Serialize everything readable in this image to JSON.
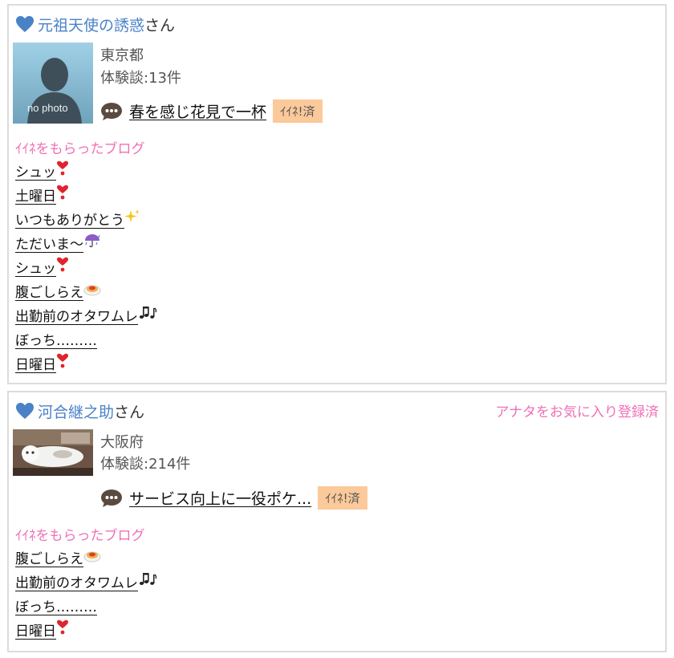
{
  "cards": [
    {
      "user_name": "元祖天使の誘惑",
      "honorific": "さん",
      "avatar_caption": "no photo",
      "prefecture": "東京都",
      "reviews": "体験談:13件",
      "latest_blog": "春を感じ花見で一杯",
      "iine_badge": "ｲｲﾈ!済",
      "liked_heading": "ｲｲﾈをもらったブログ",
      "liked_blogs": [
        {
          "title": "シュッ",
          "emoji": "heart-exclamation"
        },
        {
          "title": "土曜日",
          "emoji": "heart-exclamation"
        },
        {
          "title": "いつもありがとう",
          "emoji": "sparkles"
        },
        {
          "title": "ただいま〜",
          "emoji": "umbrella-rain"
        },
        {
          "title": "シュッ",
          "emoji": "heart-exclamation"
        },
        {
          "title": "腹ごしらえ",
          "emoji": "spaghetti"
        },
        {
          "title": "出勤前のオタワムレ",
          "emoji": "musical-notes"
        },
        {
          "title": "ぼっち………",
          "emoji": ""
        },
        {
          "title": "日曜日",
          "emoji": "heart-exclamation"
        }
      ]
    },
    {
      "user_name": "河合継之助",
      "honorific": "さん",
      "favorite_note": "アナタをお気に入り登録済",
      "prefecture": "大阪府",
      "reviews": "体験談:214件",
      "latest_blog": "サービス向上に一役ポケ...",
      "iine_badge": "ｲｲﾈ!済",
      "liked_heading": "ｲｲﾈをもらったブログ",
      "liked_blogs": [
        {
          "title": "腹ごしらえ",
          "emoji": "spaghetti"
        },
        {
          "title": "出勤前のオタワムレ",
          "emoji": "musical-notes"
        },
        {
          "title": "ぼっち………",
          "emoji": ""
        },
        {
          "title": "日曜日",
          "emoji": "heart-exclamation"
        }
      ]
    }
  ],
  "colors": {
    "user_link": "#4a82c8",
    "pink_text": "#ef70b6",
    "badge_bg": "#fbc99a",
    "card_border": "#dcdcdc"
  }
}
